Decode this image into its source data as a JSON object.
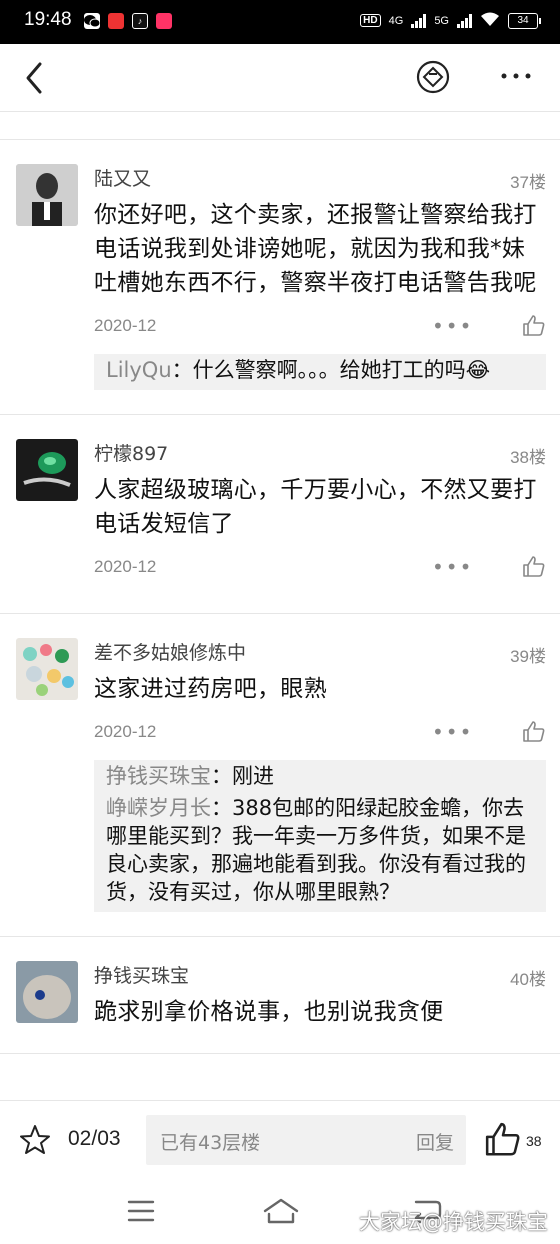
{
  "status_bar": {
    "time": "19:48",
    "hd_label": "HD",
    "net1": "4G",
    "net2": "5G",
    "battery": "34"
  },
  "header": {
    "back_icon": "chevron-left-icon",
    "share_icon": "diamond-icon",
    "more_icon": "more-horizontal-icon"
  },
  "posts": [
    {
      "author": "陆又又",
      "floor": "37楼",
      "content": "你还好吧，这个卖家，还报警让警察给我打电话说我到处诽谤她呢，就因为我和我*妹吐槽她东西不行，警察半夜打电话警告我呢",
      "date": "2020-12",
      "replies": [
        {
          "name": "LilyQu",
          "sep": "：",
          "text": "什么警察啊。。。给她打工的吗😂"
        }
      ]
    },
    {
      "author": "柠檬897",
      "floor": "38楼",
      "content": "人家超级玻璃心，千万要小心，不然又要打电话发短信了",
      "date": "2020-12",
      "replies": []
    },
    {
      "author": "差不多姑娘修炼中",
      "floor": "39楼",
      "content": "这家进过药房吧，眼熟",
      "date": "2020-12",
      "replies": [
        {
          "name": "挣钱买珠宝",
          "sep": "：",
          "text": "刚进"
        },
        {
          "name": "峥嵘岁月长",
          "sep": "：",
          "text": "388包邮的阳绿起胶金蟾，你去哪里能买到？我一年卖一万多件货，如果不是良心卖家，那遍地能看到我。你没有看过我的货，没有买过，你从哪里眼熟？"
        }
      ]
    },
    {
      "author": "挣钱买珠宝",
      "floor": "40楼",
      "content": "跪求别拿价格说事，也别说我贪便",
      "date": "",
      "replies": []
    }
  ],
  "bottom_bar": {
    "page_indicator": "02/03",
    "reply_placeholder": "已有43层楼",
    "reply_button": "回复",
    "like_count": "38"
  },
  "nav_bar": {
    "watermark": "大家坛@挣钱买珠宝"
  },
  "colors": {
    "status_bg": "#000000",
    "reply_bg": "#f1f1f1",
    "muted_text": "#888888",
    "divider": "#e6e6e6"
  }
}
